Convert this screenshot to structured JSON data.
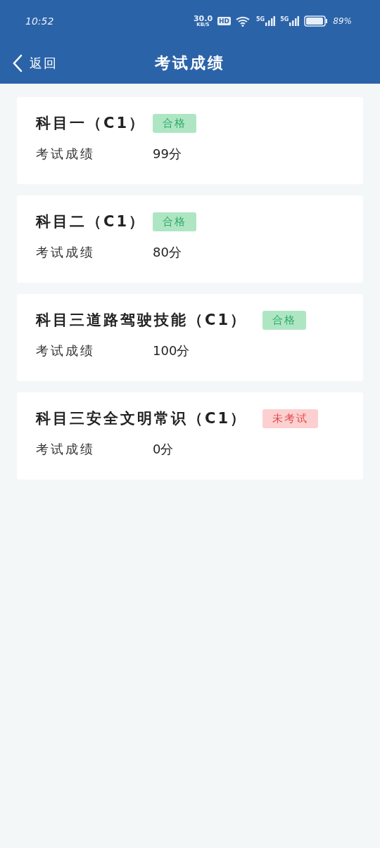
{
  "status_bar": {
    "time": "10:52",
    "net_speed": "30.0",
    "net_unit": "KB/S",
    "hd": "HD",
    "signal_1": "5G",
    "signal_2": "5G",
    "battery": "89%"
  },
  "nav": {
    "back": "返回",
    "title": "考试成绩"
  },
  "results": [
    {
      "subject": "科目一（C1）",
      "status": "合格",
      "kind": "pass",
      "label": "考试成绩",
      "score": "99分"
    },
    {
      "subject": "科目二（C1）",
      "status": "合格",
      "kind": "pass",
      "label": "考试成绩",
      "score": "80分"
    },
    {
      "subject": "科目三道路驾驶技能（C1）",
      "status": "合格",
      "kind": "pass",
      "label": "考试成绩",
      "score": "100分"
    },
    {
      "subject": "科目三安全文明常识（C1）",
      "status": "未考试",
      "kind": "not_taken",
      "label": "考试成绩",
      "score": "0分"
    }
  ]
}
